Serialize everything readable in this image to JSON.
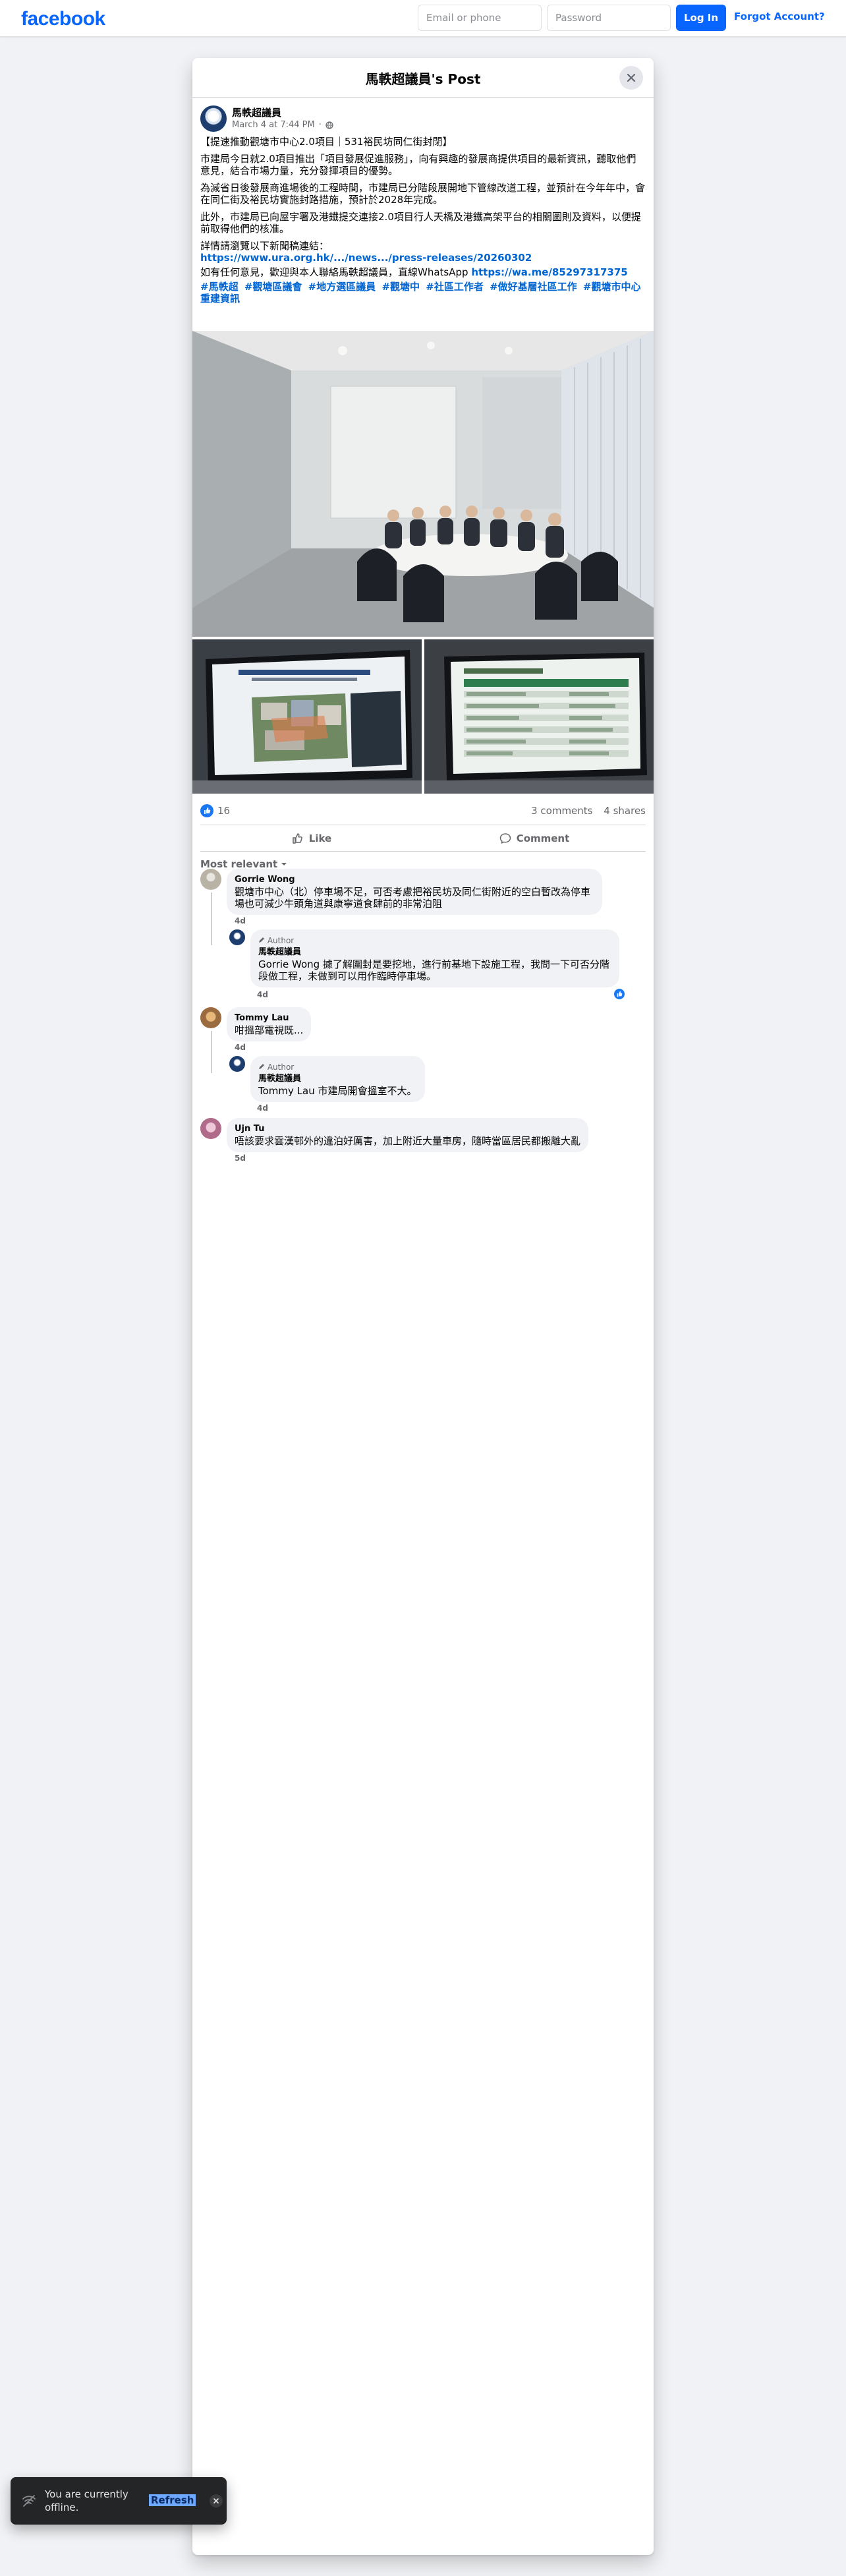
{
  "topbar": {
    "logo": "facebook",
    "email_placeholder": "Email or phone",
    "password_placeholder": "Password",
    "login_label": "Log In",
    "forgot_label": "Forgot Account?"
  },
  "dialog": {
    "title": "馬軼超議員's Post"
  },
  "post": {
    "author": "馬軼超議員",
    "timestamp": "March 4 at 7:44 PM",
    "privacy_icon": "globe-icon",
    "paragraphs": [
      "【提速推動觀塘市中心2.0項目｜531裕民坊同仁街封閉】",
      "市建局今日就2.0項目推出「項目發展促進服務」，向有興趣的發展商提供項目的最新資訊，聽取他們意見，結合市場力量，充分發揮項目的優勢。",
      "為減省日後發展商進場後的工程時間，市建局已分階段展開地下管線改道工程，並預計在今年年中，會在同仁街及裕民坊實施封路措施，預計於2028年完成。",
      "此外，市建局已向屋宇署及港鐵提交連接2.0項目行人天橋及港鐵高架平台的相關圖則及資料，以便提前取得他們的核准。"
    ],
    "press_intro": "詳情請瀏覽以下新聞稿連結：",
    "press_link": "https://www.ura.org.hk/.../news.../press-releases/20260302",
    "contact_text": "如有任何意見，歡迎與本人聯絡馬軼超議員，直線WhatsApp ",
    "whatsapp_link": "https://wa.me/85297317375",
    "hashtags": [
      "#馬軼超",
      "#觀塘區議會",
      "#地方選區議員",
      "#觀塘中",
      "#社區工作者",
      "#做好基層社區工作",
      "#觀塘市中心重建資訊"
    ]
  },
  "photos": {
    "main_alt": "meeting-room-photo",
    "left_alt": "screen-aerial-plan-photo",
    "right_alt": "screen-table-photo"
  },
  "stats": {
    "likes": "16",
    "comments": "3 comments",
    "shares": "4 shares"
  },
  "actions": {
    "like": "Like",
    "comment": "Comment"
  },
  "sort_label": "Most relevant",
  "comments": [
    {
      "name": "Gorrie Wong",
      "text": "觀塘市中心（北）停車場不足，可否考慮把裕民坊及同仁街附近的空白暫改為停車場也可減少牛頭角道與康寧道食肆前的非常泊阻",
      "time": "4d",
      "reply": {
        "tag": "Author",
        "name": "馬軼超議員",
        "text": "Gorrie Wong 據了解圍封是要挖地，進行前基地下設施工程，我問一下可否分階段做工程，未做到可以用作臨時停車場。",
        "time": "4d"
      }
    },
    {
      "name": "Tommy Lau",
      "text": "咁搵部電視既...",
      "time": "4d",
      "reply": {
        "tag": "Author",
        "name": "馬軼超議員",
        "text": "Tommy Lau 市建局開會搵室不大。",
        "time": "4d"
      }
    },
    {
      "name": "Ujn Tu",
      "text": "唔該要求雲漢邨外的違泊好厲害，加上附近大量車房，隨時當區居民都搬離大亂",
      "time": "5d"
    }
  ],
  "toast": {
    "text": "You are currently offline.",
    "refresh": "Refresh"
  }
}
